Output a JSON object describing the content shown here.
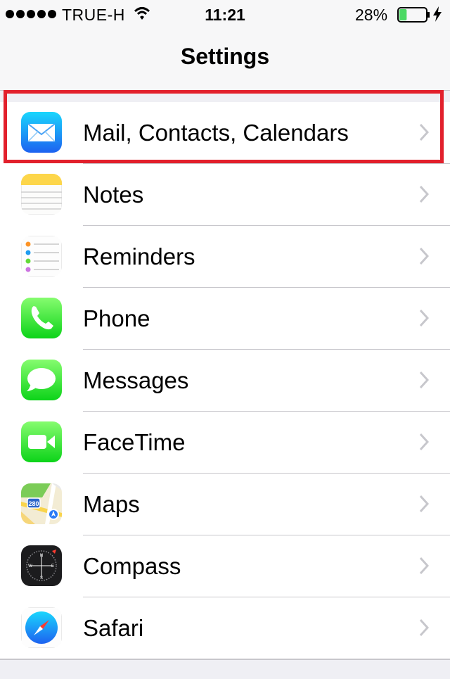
{
  "status_bar": {
    "carrier": "TRUE-H",
    "time": "11:21",
    "battery_percent": "28%",
    "battery_level": 0.28
  },
  "nav": {
    "title": "Settings"
  },
  "rows": [
    {
      "label": "Mail, Contacts, Calendars",
      "icon": "mail-icon"
    },
    {
      "label": "Notes",
      "icon": "notes-icon"
    },
    {
      "label": "Reminders",
      "icon": "reminders-icon"
    },
    {
      "label": "Phone",
      "icon": "phone-icon"
    },
    {
      "label": "Messages",
      "icon": "messages-icon"
    },
    {
      "label": "FaceTime",
      "icon": "facetime-icon"
    },
    {
      "label": "Maps",
      "icon": "maps-icon"
    },
    {
      "label": "Compass",
      "icon": "compass-icon"
    },
    {
      "label": "Safari",
      "icon": "safari-icon"
    }
  ],
  "maps_badge": "280",
  "colors": {
    "highlight": "#e2202c",
    "separator": "#c8c7cc",
    "chevron": "#c7c7cc",
    "background": "#efeff4"
  }
}
